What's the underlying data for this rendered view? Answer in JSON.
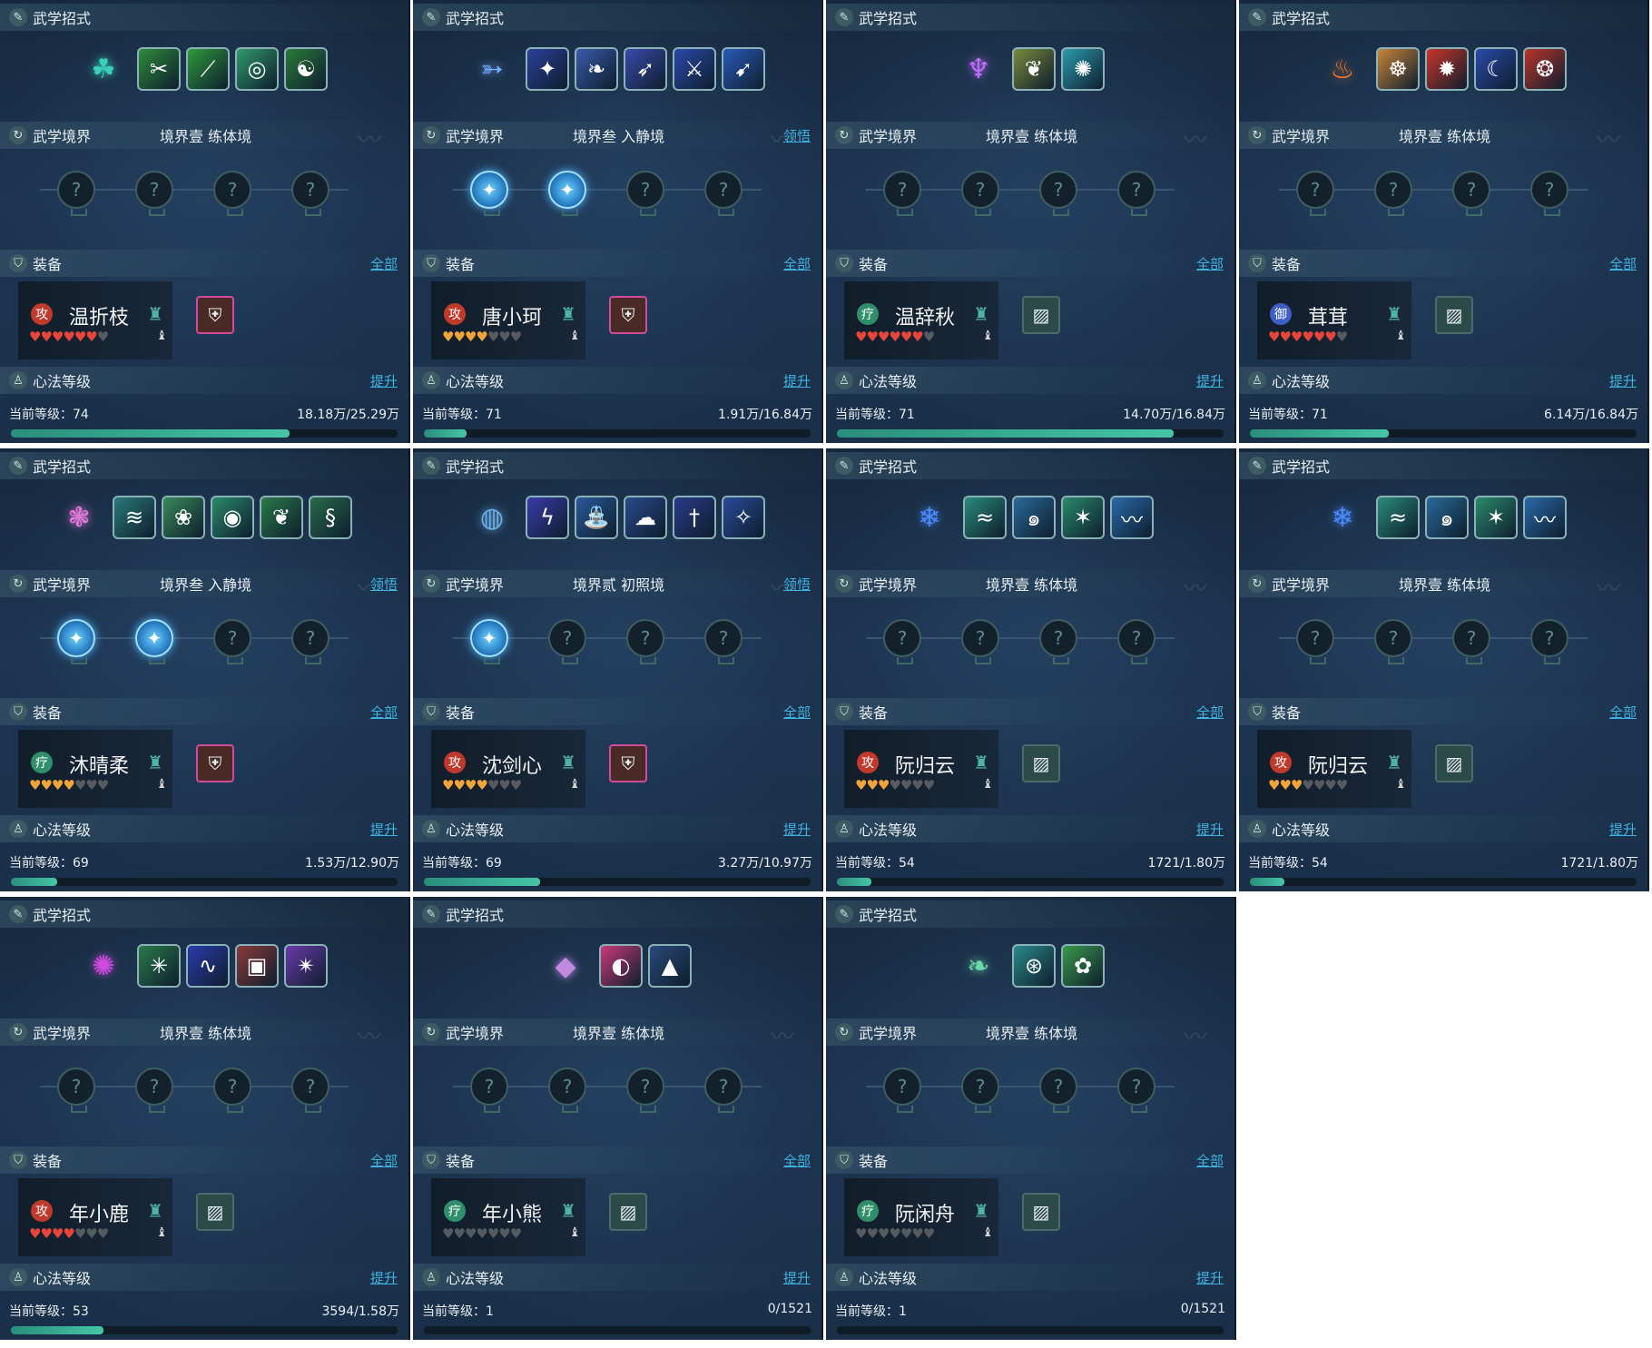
{
  "labels": {
    "skills_header": "武学招式",
    "realm_header": "武学境界",
    "equip_header": "装备",
    "equip_all": "全部",
    "mind_header": "心法等级",
    "mind_up": "提升",
    "realm_action": "领悟",
    "level_prefix": "当前等级："
  },
  "colors": {
    "accent": "#3fb3e0",
    "heart_red": "#e8453b",
    "heart_gold": "#f0a43a",
    "heart_empty": "#555b60",
    "badge_attack": "#c0392b",
    "badge_heal": "#2f8f6a",
    "badge_defense": "#3d5fc4"
  },
  "characters": [
    {
      "name": "温折枝",
      "role_badge": "攻",
      "role_type": "attack",
      "hearts": [
        "red",
        "red",
        "red",
        "red",
        "red",
        "red",
        "empty"
      ],
      "heart_color": "red",
      "realm_text": "境界壹",
      "realm_stage": "练体境",
      "realm_action": "",
      "realm_nodes_active": 0,
      "main_skill_icon": "green-spirit-icon",
      "main_skill_color": "#39d0b8",
      "skill_icons": [
        "leaf-slash-icon",
        "green-slash-icon",
        "ring-icon",
        "swirl-icon"
      ],
      "skill_colors": [
        "#2f8a3a",
        "#2f9a3a",
        "#2f9a6a",
        "#2a7a3a"
      ],
      "gear_owned": true,
      "gear_icon": "armor-icon",
      "level": "74",
      "exp_text": "18.18万/25.29万",
      "progress": 0.72
    },
    {
      "name": "唐小珂",
      "role_badge": "攻",
      "role_type": "attack",
      "hearts": [
        "gold",
        "gold",
        "gold",
        "gold",
        "empty",
        "empty",
        "empty"
      ],
      "heart_color": "gold",
      "realm_text": "境界叁",
      "realm_stage": "入静境",
      "realm_action": "领悟",
      "realm_nodes_active": 2,
      "main_skill_icon": "blue-bird-icon",
      "main_skill_color": "#7aaeff",
      "skill_icons": [
        "blue-strike-icon",
        "feather-icon",
        "dash-icon",
        "blade-icon",
        "spear-icon"
      ],
      "skill_colors": [
        "#2a3f9a",
        "#3a5aaa",
        "#3a4aaa",
        "#2a4aaa",
        "#2a5aba"
      ],
      "gear_owned": true,
      "gear_icon": "demon-armor-icon",
      "level": "71",
      "exp_text": "1.91万/16.84万",
      "progress": 0.11
    },
    {
      "name": "温辞秋",
      "role_badge": "疗",
      "role_type": "heal",
      "hearts": [
        "red",
        "red",
        "red",
        "red",
        "red",
        "red",
        "empty"
      ],
      "heart_color": "red",
      "realm_text": "境界壹",
      "realm_stage": "练体境",
      "realm_action": "",
      "realm_nodes_active": 0,
      "main_skill_icon": "purple-figure-icon",
      "main_skill_color": "#c26bff",
      "skill_icons": [
        "wing-icon",
        "sun-ring-icon"
      ],
      "skill_colors": [
        "#7a8a3a",
        "#2a9aaa"
      ],
      "gear_owned": false,
      "gear_icon": "empty-gear-icon",
      "level": "71",
      "exp_text": "14.70万/16.84万",
      "progress": 0.87
    },
    {
      "name": "茸茸",
      "role_badge": "御",
      "role_type": "defense",
      "hearts": [
        "red",
        "red",
        "red",
        "red",
        "red",
        "red",
        "empty"
      ],
      "heart_color": "red",
      "realm_text": "境界壹",
      "realm_stage": "练体境",
      "realm_action": "",
      "realm_nodes_active": 0,
      "main_skill_icon": "fire-figure-icon",
      "main_skill_color": "#ff7a2a",
      "skill_icons": [
        "buddha-icon",
        "explosion-icon",
        "moon-icon",
        "flame-swirl-icon"
      ],
      "skill_colors": [
        "#c9853a",
        "#c9352a",
        "#2a4aaa",
        "#b9352a"
      ],
      "gear_owned": false,
      "gear_icon": "empty-gear-icon",
      "level": "71",
      "exp_text": "6.14万/16.84万",
      "progress": 0.36
    },
    {
      "name": "沐晴柔",
      "role_badge": "疗",
      "role_type": "heal",
      "hearts": [
        "gold",
        "gold",
        "gold",
        "gold",
        "empty",
        "empty",
        "empty"
      ],
      "heart_color": "gold",
      "realm_text": "境界叁",
      "realm_stage": "入静境",
      "realm_action": "领悟",
      "realm_nodes_active": 2,
      "main_skill_icon": "pink-dancer-icon",
      "main_skill_color": "#e07ad8",
      "skill_icons": [
        "wave-icon",
        "leaf-fan-icon",
        "vortex-icon",
        "leaf-icon",
        "vine-icon"
      ],
      "skill_colors": [
        "#2a7a7a",
        "#3a8a5a",
        "#2a8a6a",
        "#2a7a4a",
        "#2a6a4a"
      ],
      "gear_owned": true,
      "gear_icon": "golden-armor-icon",
      "level": "69",
      "exp_text": "1.53万/12.90万",
      "progress": 0.12
    },
    {
      "name": "沈剑心",
      "role_badge": "攻",
      "role_type": "attack",
      "hearts": [
        "gold",
        "gold",
        "gold",
        "gold",
        "empty",
        "empty",
        "empty"
      ],
      "heart_color": "gold",
      "realm_text": "境界贰",
      "realm_stage": "初照境",
      "realm_action": "领悟",
      "realm_nodes_active": 1,
      "main_skill_icon": "blue-sphere-icon",
      "main_skill_color": "#6ab0e8",
      "skill_icons": [
        "lightning-icon",
        "fountain-icon",
        "cloud-slash-icon",
        "sword-pillar-icon",
        "spin-icon"
      ],
      "skill_colors": [
        "#3a3aaa",
        "#2a5a9a",
        "#2a4a8a",
        "#2a3a8a",
        "#2a4a9a"
      ],
      "gear_owned": true,
      "gear_icon": "armor-icon",
      "level": "69",
      "exp_text": "3.27万/10.97万",
      "progress": 0.3
    },
    {
      "name": "阮归云",
      "role_badge": "攻",
      "role_type": "attack",
      "hearts": [
        "gold",
        "gold",
        "gold",
        "empty",
        "empty",
        "empty",
        "empty"
      ],
      "heart_color": "gold",
      "realm_text": "境界壹",
      "realm_stage": "练体境",
      "realm_action": "",
      "realm_nodes_active": 0,
      "main_skill_icon": "water-spirit-icon",
      "main_skill_color": "#4a8aff",
      "skill_icons": [
        "stream-icon",
        "cyclone-icon",
        "star-burst-icon",
        "tide-icon"
      ],
      "skill_colors": [
        "#2a8a7a",
        "#2a6a9a",
        "#2a8a6a",
        "#2a6aaa"
      ],
      "gear_owned": false,
      "gear_icon": "empty-gear-icon",
      "level": "54",
      "exp_text": "1721/1.80万",
      "progress": 0.09
    },
    {
      "name": "阮归云",
      "role_badge": "攻",
      "role_type": "attack",
      "hearts": [
        "gold",
        "gold",
        "gold",
        "empty",
        "empty",
        "empty",
        "empty"
      ],
      "heart_color": "gold",
      "realm_text": "境界壹",
      "realm_stage": "练体境",
      "realm_action": "",
      "realm_nodes_active": 0,
      "main_skill_icon": "water-spirit-icon",
      "main_skill_color": "#4a8aff",
      "skill_icons": [
        "stream-icon",
        "cyclone-icon",
        "star-burst-icon",
        "tide-icon"
      ],
      "skill_colors": [
        "#2a8a7a",
        "#2a6a9a",
        "#2a8a6a",
        "#2a6aaa"
      ],
      "gear_owned": false,
      "gear_icon": "empty-gear-icon",
      "level": "54",
      "exp_text": "1721/1.80万",
      "progress": 0.09
    },
    {
      "name": "年小鹿",
      "role_badge": "攻",
      "role_type": "attack",
      "hearts": [
        "red",
        "red",
        "red",
        "red",
        "empty",
        "empty",
        "empty"
      ],
      "heart_color": "red",
      "realm_text": "境界壹",
      "realm_stage": "练体境",
      "realm_action": "",
      "realm_nodes_active": 0,
      "main_skill_icon": "purple-orb-icon",
      "main_skill_color": "#d04ae0",
      "skill_icons": [
        "green-burst-icon",
        "blue-wave-icon",
        "rock-icon",
        "purple-strike-icon"
      ],
      "skill_colors": [
        "#2a7a4a",
        "#2a3aaa",
        "#8a3a3a",
        "#6a3aaa"
      ],
      "gear_owned": false,
      "gear_icon": "empty-gear-icon",
      "level": "53",
      "exp_text": "3594/1.58万",
      "progress": 0.24
    },
    {
      "name": "年小熊",
      "role_badge": "疗",
      "role_type": "heal",
      "hearts": [
        "empty",
        "empty",
        "empty",
        "empty",
        "empty",
        "empty",
        "empty"
      ],
      "heart_color": "gold",
      "realm_text": "境界壹",
      "realm_stage": "练体境",
      "realm_action": "",
      "realm_nodes_active": 0,
      "main_skill_icon": "crystal-icon",
      "main_skill_color": "#c08ae0",
      "skill_icons": [
        "pink-mask-icon",
        "shark-icon"
      ],
      "skill_colors": [
        "#c93a7a",
        "#2a4a7a"
      ],
      "gear_owned": false,
      "gear_icon": "empty-gear-icon",
      "level": "1",
      "exp_text": "0/1521",
      "progress": 0
    },
    {
      "name": "阮闲舟",
      "role_badge": "疗",
      "role_type": "heal",
      "hearts": [
        "empty",
        "empty",
        "empty",
        "empty",
        "empty",
        "empty",
        "empty"
      ],
      "heart_color": "gold",
      "realm_text": "境界壹",
      "realm_stage": "练体境",
      "realm_action": "",
      "realm_nodes_active": 0,
      "main_skill_icon": "leaf-gem-icon",
      "main_skill_color": "#6ad8a8",
      "skill_icons": [
        "orbit-icon",
        "daisy-icon"
      ],
      "skill_colors": [
        "#2a8a8a",
        "#3a9a4a"
      ],
      "gear_owned": false,
      "gear_icon": "empty-gear-icon",
      "level": "1",
      "exp_text": "0/1521",
      "progress": 0
    }
  ]
}
